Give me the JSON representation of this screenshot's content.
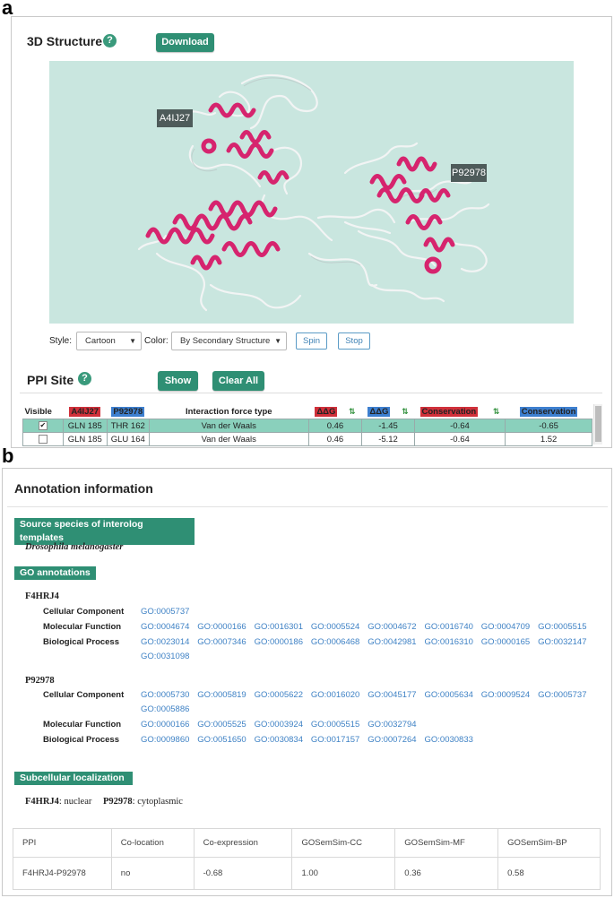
{
  "panel_a": {
    "label": "a",
    "structure_title": "3D Structure",
    "help": "?",
    "download_label": "Download",
    "chain_a_tag": "A4IJ27",
    "chain_b_tag": "P92978",
    "style_label": "Style:",
    "style_value": "Cartoon",
    "color_label": "Color:",
    "color_value": "By Secondary Structure",
    "spin_label": "Spin",
    "stop_label": "Stop",
    "ppi_title": "PPI Site",
    "show_label": "Show",
    "clear_label": "Clear All",
    "table": {
      "headers": {
        "visible": "Visible",
        "chain_a": "A4IJ27",
        "chain_b": "P92978",
        "force": "Interaction force type",
        "ddg_a": "ΔΔG",
        "ddg_b": "ΔΔG",
        "cons_a": "Conservation",
        "cons_b": "Conservation"
      },
      "rows": [
        {
          "checked": "✔",
          "a": "GLN 185",
          "b": "THR 162",
          "force": "Van der Waals",
          "ddg_a": "0.46",
          "ddg_b": "-1.45",
          "cons_a": "-0.64",
          "cons_b": "-0.65"
        },
        {
          "checked": "",
          "a": "GLN 185",
          "b": "GLU 164",
          "force": "Van der Waals",
          "ddg_a": "0.46",
          "ddg_b": "-5.12",
          "cons_a": "-0.64",
          "cons_b": "1.52"
        }
      ]
    }
  },
  "panel_b": {
    "label": "b",
    "title": "Annotation information",
    "source_header": "Source species of interolog templates",
    "source_species": "Drosophila melanogaster",
    "go_header": "GO annotations",
    "proteins": [
      {
        "name": "F4HRJ4",
        "cc_label": "Cellular Component",
        "cc": [
          "GO:0005737"
        ],
        "mf_label": "Molecular Function",
        "mf": [
          "GO:0004674",
          "GO:0000166",
          "GO:0016301",
          "GO:0005524",
          "GO:0004672",
          "GO:0016740",
          "GO:0004709",
          "GO:0005515"
        ],
        "bp_label": "Biological Process",
        "bp": [
          "GO:0023014",
          "GO:0007346",
          "GO:0000186",
          "GO:0006468",
          "GO:0042981",
          "GO:0016310",
          "GO:0000165",
          "GO:0032147",
          "GO:0031098"
        ]
      },
      {
        "name": "P92978",
        "cc_label": "Cellular Component",
        "cc": [
          "GO:0005730",
          "GO:0005819",
          "GO:0005622",
          "GO:0016020",
          "GO:0045177",
          "GO:0005634",
          "GO:0009524",
          "GO:0005737",
          "GO:0005886"
        ],
        "mf_label": "Molecular Function",
        "mf": [
          "GO:0000166",
          "GO:0005525",
          "GO:0003924",
          "GO:0005515",
          "GO:0032794"
        ],
        "bp_label": "Biological Process",
        "bp": [
          "GO:0009860",
          "GO:0051650",
          "GO:0030834",
          "GO:0017157",
          "GO:0007264",
          "GO:0030833"
        ]
      }
    ],
    "subcell_header": "Subcellular localization",
    "subcell": {
      "p1_name": "F4HRJ4",
      "p1_loc": ": nuclear",
      "p2_name": "P92978",
      "p2_loc": ":  cytoplasmic"
    },
    "summary": {
      "headers": [
        "PPI",
        "Co-location",
        "Co-expression",
        "GOSemSim-CC",
        "GOSemSim-MF",
        "GOSemSim-BP"
      ],
      "row": [
        "F4HRJ4-P92978",
        "no",
        "-0.68",
        "1.00",
        "0.36",
        "0.58"
      ]
    }
  },
  "colors": {
    "accent": "#2f8f74",
    "viewer_bg": "#c9e6df",
    "helix": "#d6246e",
    "link": "#3f82c5",
    "chain_a_highlight": "#d0303a",
    "chain_b_highlight": "#3d7fcf",
    "selected_row": "#8ad0bc"
  }
}
